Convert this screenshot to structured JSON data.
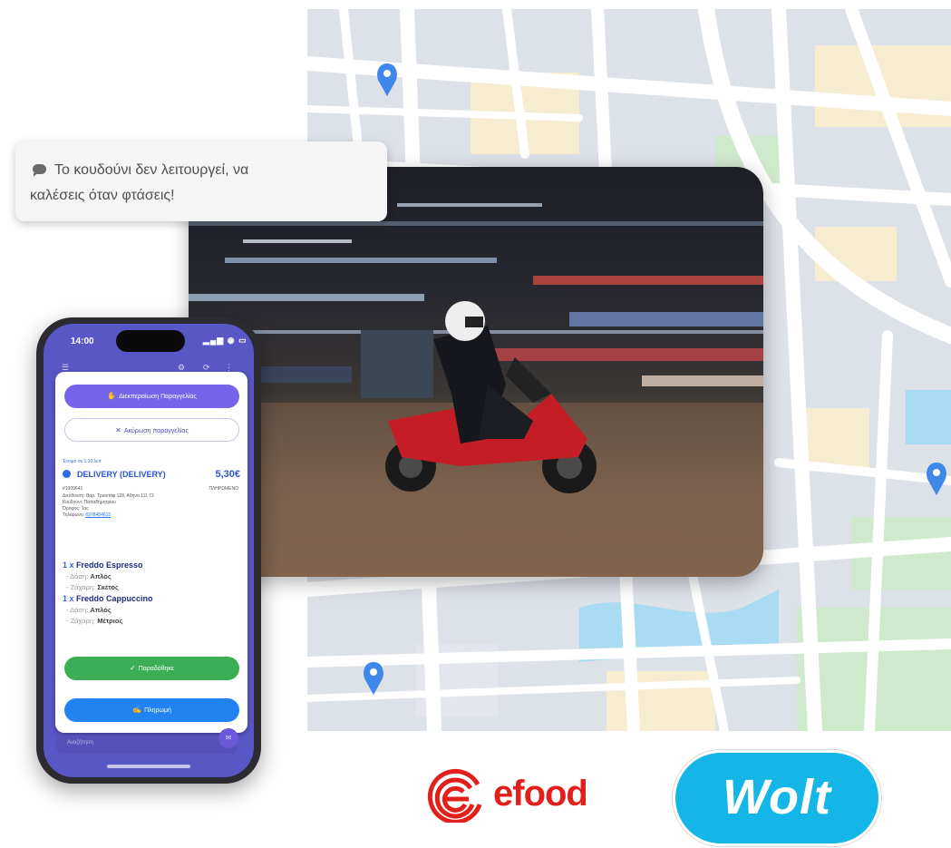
{
  "chat_bubble": {
    "icon": "chat-icon",
    "line1": "Το κουδούνι δεν λειτουργεί, να",
    "line2": "καλέσεις όταν φτάσεις!"
  },
  "map": {
    "pins": [
      "map-pin-icon",
      "map-pin-icon",
      "map-pin-icon"
    ],
    "pin_color": "#3f87e8"
  },
  "photo": {
    "subject": "delivery-rider-on-red-scooter"
  },
  "phone": {
    "status_time": "14:00",
    "order_card": {
      "accept_label": "Διεκπεραίωση Παραγγελίας",
      "cancel_label": "Ακύρωση παραγγελίας",
      "time_text": "Έτοιμο σε 1:10 λεπ",
      "order_type": "DELIVERY (DELIVERY)",
      "price": "5,30€",
      "order_id": "#1009641",
      "payment": "ΠΛΗΡΩΜΕΝΟ",
      "address": "Διεύθυνση: Βαρ. Τριανταφ 128, Αθήνα 111 72",
      "note": "Κουδούνι: Παπαδημητρίου",
      "floor": "Όροφος: 1ος",
      "phone_label": "Τηλέφωνο:",
      "phone_value": "6978484615",
      "items": [
        {
          "qty": "1 x",
          "name": "Freddo Espresso",
          "options": [
            {
              "label": "- Δόση:",
              "value": "Απλός"
            },
            {
              "label": "- Ζάχαρη:",
              "value": "Σκέτος"
            }
          ]
        },
        {
          "qty": "1 x",
          "name": "Freddo Cappuccino",
          "options": [
            {
              "label": "- Δόση:",
              "value": "Απλός"
            },
            {
              "label": "- Ζάχαρη:",
              "value": "Μέτριος"
            }
          ]
        }
      ],
      "deliver_label": "Παραδόθηκε",
      "pay_label": "Πληρωμή"
    },
    "bottom_input_placeholder": "Αναζήτηση"
  },
  "brands": {
    "efood": "efood",
    "efood_color": "#e2201b",
    "wolt": "Wolt",
    "wolt_color": "#13b6e6"
  }
}
